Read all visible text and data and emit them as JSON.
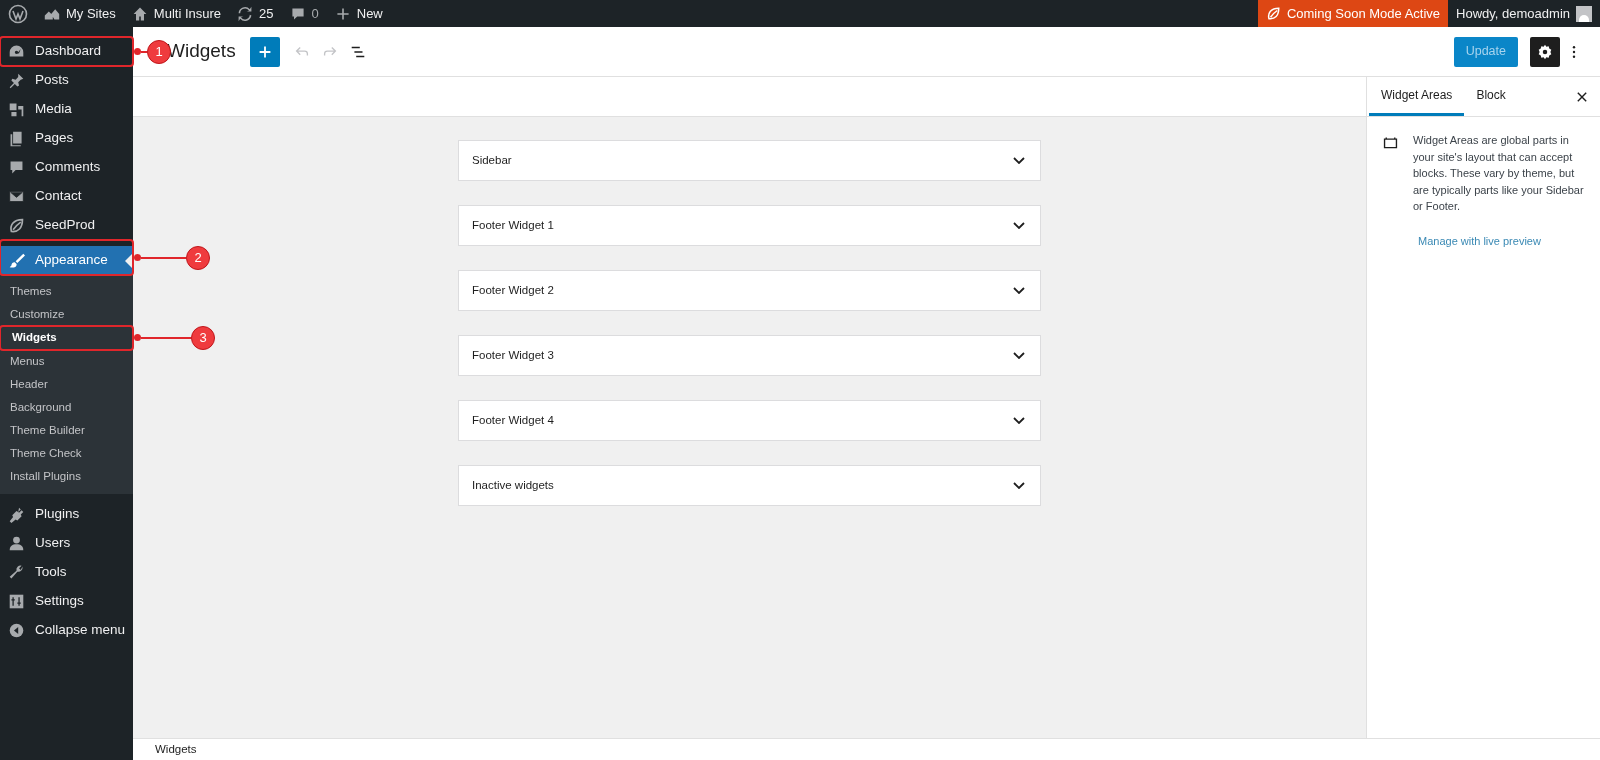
{
  "admin_bar": {
    "items": [
      {
        "kind": "logo"
      },
      {
        "kind": "sites",
        "label": "My Sites"
      },
      {
        "kind": "home",
        "label": "Multi Insure"
      },
      {
        "kind": "updates",
        "label": "25"
      },
      {
        "kind": "comments",
        "label": "0"
      },
      {
        "kind": "new",
        "label": "New"
      }
    ],
    "notice": "Coming Soon Mode Active",
    "greeting": "Howdy, demoadmin"
  },
  "sidebar": {
    "items": [
      {
        "kind": "dashboard",
        "label": "Dashboard",
        "selected": false,
        "callout": "1"
      },
      {
        "kind": "pin",
        "label": "Posts",
        "selected": false
      },
      {
        "kind": "media",
        "label": "Media",
        "selected": false
      },
      {
        "kind": "pages",
        "label": "Pages",
        "selected": false
      },
      {
        "kind": "comments",
        "label": "Comments",
        "selected": false
      },
      {
        "kind": "mail",
        "label": "Contact",
        "selected": false
      },
      {
        "kind": "leaf",
        "label": "SeedProd",
        "selected": false
      },
      {
        "kind": "brush",
        "label": "Appearance",
        "selected": true,
        "callout": "2",
        "children": [
          {
            "label": "Themes",
            "selected": false
          },
          {
            "label": "Customize",
            "selected": false
          },
          {
            "label": "Widgets",
            "selected": true,
            "callout": "3"
          },
          {
            "label": "Menus",
            "selected": false
          },
          {
            "label": "Header",
            "selected": false
          },
          {
            "label": "Background",
            "selected": false
          },
          {
            "label": "Theme Builder",
            "selected": false
          },
          {
            "label": "Theme Check",
            "selected": false
          },
          {
            "label": "Install Plugins",
            "selected": false
          }
        ]
      },
      {
        "kind": "plug",
        "label": "Plugins",
        "selected": false
      },
      {
        "kind": "user",
        "label": "Users",
        "selected": false
      },
      {
        "kind": "wrench",
        "label": "Tools",
        "selected": false
      },
      {
        "kind": "sliders",
        "label": "Settings",
        "selected": false
      },
      {
        "kind": "collapse",
        "label": "Collapse menu",
        "selected": false
      }
    ]
  },
  "editor": {
    "title": "Widgets",
    "undo_disabled": true,
    "redo_disabled": true,
    "update_label": "Update",
    "update_disabled": true
  },
  "widget_areas": [
    "Sidebar",
    "Footer Widget 1",
    "Footer Widget 2",
    "Footer Widget 3",
    "Footer Widget 4",
    "Inactive widgets"
  ],
  "panel": {
    "tabs": [
      {
        "label": "Widget Areas",
        "selected": true
      },
      {
        "label": "Block",
        "selected": false
      }
    ],
    "description": "Widget Areas are global parts in your site's layout that can accept blocks. These vary by theme, but are typically parts like your Sidebar or Footer.",
    "link": "Manage with live preview"
  },
  "footer": {
    "breadcrumb": "Widgets"
  }
}
